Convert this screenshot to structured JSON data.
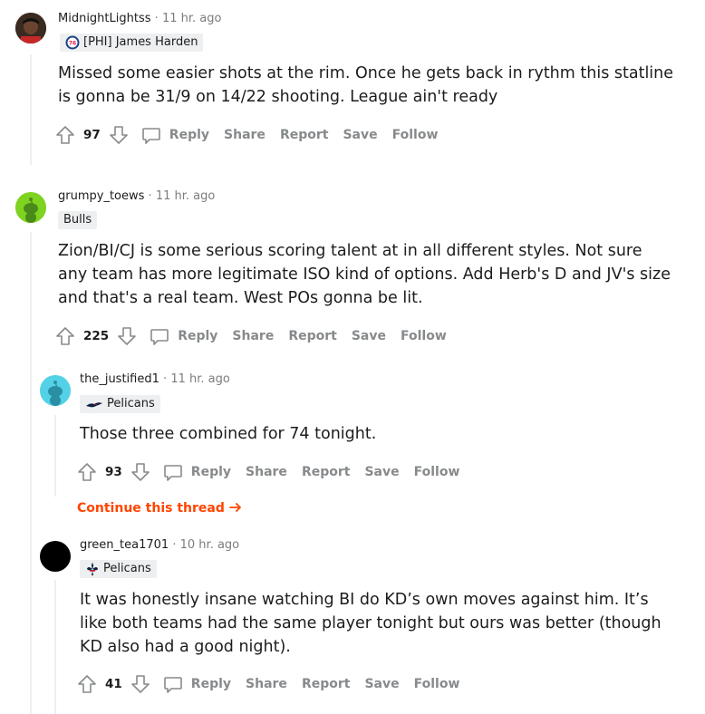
{
  "comments": [
    {
      "author": "MidnightLightss",
      "time": "11 hr. ago",
      "flair": "[PHI] James Harden",
      "body": "Missed some easier shots at the rim. Once he gets back in rythm this statline is gonna be 31/9 on 14/22 shooting. League ain't ready",
      "votes": "97"
    },
    {
      "author": "grumpy_toews",
      "time": "11 hr. ago",
      "flair": "Bulls",
      "body": "Zion/BI/CJ is some serious scoring talent at in all different styles. Not sure any team has more legitimate ISO kind of options. Add Herb's D and JV's size and that's a real team. West POs gonna be lit.",
      "votes": "225"
    },
    {
      "author": "the_justified1",
      "time": "11 hr. ago",
      "flair": "Pelicans",
      "body": "Those three combined for 74 tonight.",
      "votes": "93"
    },
    {
      "author": "green_tea1701",
      "time": "10 hr. ago",
      "flair": "Pelicans",
      "body": "It was honestly insane watching BI do KD’s own moves against him. It’s like both teams had the same player tonight but ours was better (though KD also had a good night).",
      "votes": "41"
    }
  ],
  "actions": {
    "reply": "Reply",
    "share": "Share",
    "report": "Report",
    "save": "Save",
    "follow": "Follow"
  },
  "separator": "·",
  "continue_thread": "Continue this thread",
  "colors": {
    "accent": "#ff4500",
    "muted": "#878a8c",
    "flair_bg": "#edeff1"
  },
  "icons": [
    "upvote-icon",
    "downvote-icon",
    "comment-bubble-icon",
    "arrow-right-icon",
    "sixers-logo-icon",
    "pelicans-bird-icon",
    "fleur-de-lis-icon",
    "snoo-avatar-icon"
  ]
}
